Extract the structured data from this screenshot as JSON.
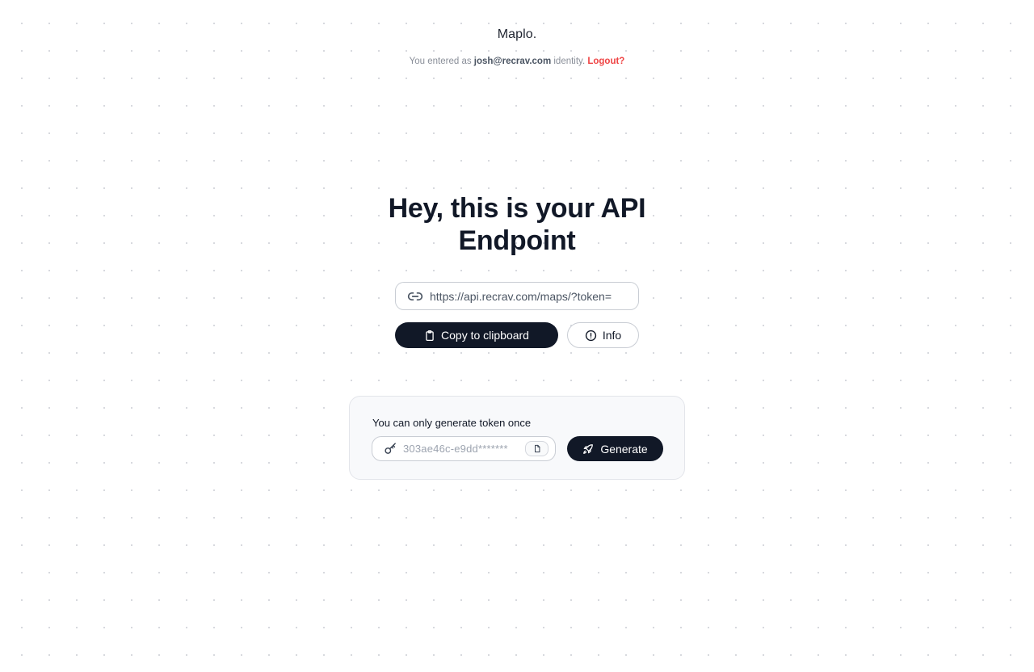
{
  "brand": {
    "name": "Maplo."
  },
  "identity": {
    "prefix": "You entered as",
    "email": "josh@recrav.com",
    "suffix": "identity.",
    "logout_label": "Logout?"
  },
  "main": {
    "headline_line1": "Hey, this is your API",
    "headline_line2": "Endpoint",
    "endpoint_url": "https://api.recrav.com/maps/?token=",
    "copy_label": "Copy to clipboard",
    "info_label": "Info"
  },
  "token_card": {
    "notice": "You can only generate token once",
    "token_value": "303ae46c-e9dd*******",
    "generate_label": "Generate"
  },
  "icons": {
    "link": "link-icon",
    "clipboard": "clipboard-icon",
    "info": "info-icon",
    "key": "key-icon",
    "copy": "copy-icon",
    "rocket": "rocket-icon"
  },
  "colors": {
    "primary": "#111827",
    "logout": "#ef4444",
    "muted": "#8a8f99"
  }
}
